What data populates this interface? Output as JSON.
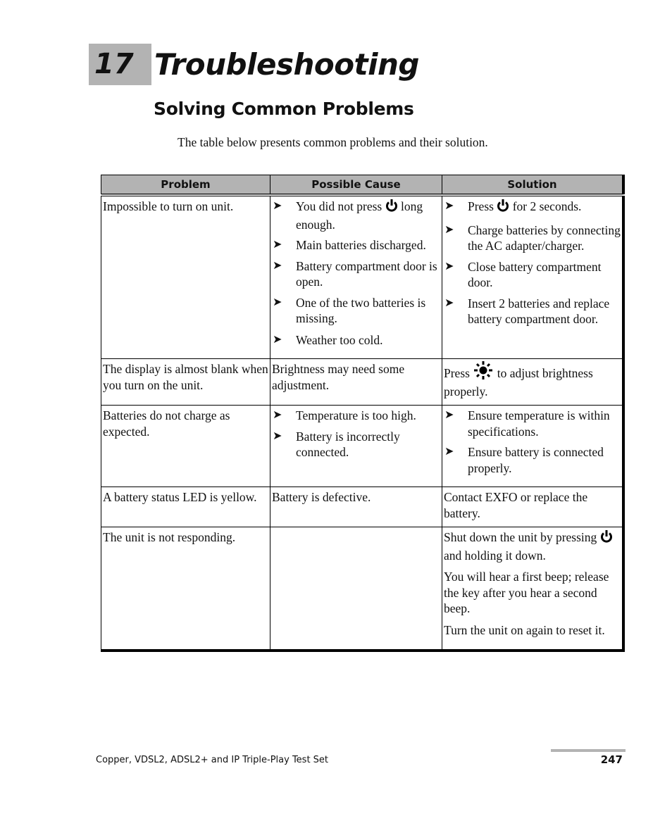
{
  "chapter": {
    "number": "17",
    "title": "Troubleshooting"
  },
  "section": {
    "title": "Solving Common Problems"
  },
  "intro": "The table below presents common problems and their solution.",
  "table": {
    "headers": [
      "Problem",
      "Possible Cause",
      "Solution"
    ],
    "rows": [
      {
        "problem": "Impossible to turn on unit.",
        "causes": [
          {
            "pre": "You did not press ",
            "icon": "power-icon",
            "post": " long enough."
          },
          {
            "pre": "Main batteries discharged."
          },
          {
            "pre": "Battery compartment door is open."
          },
          {
            "pre": "One of the two batteries is missing."
          },
          {
            "pre": "Weather too cold."
          }
        ],
        "solutions": [
          {
            "pre": "Press ",
            "icon": "power-icon",
            "post": " for 2 seconds."
          },
          {
            "pre": "Charge batteries by connecting the AC adapter/charger."
          },
          {
            "pre": "Close battery compartment door."
          },
          {
            "pre": "Insert 2 batteries and replace battery compartment door."
          }
        ]
      },
      {
        "problem": "The display is almost blank when you turn on the unit.",
        "cause": "Brightness may need some adjustment.",
        "solution": {
          "pre": "Press ",
          "icon": "brightness-icon",
          "post": " to adjust brightness properly."
        }
      },
      {
        "problem": "Batteries do not charge as expected.",
        "causes": [
          {
            "pre": "Temperature is too high."
          },
          {
            "pre": "Battery is incorrectly connected."
          }
        ],
        "solutions": [
          {
            "pre": "Ensure temperature is within specifications."
          },
          {
            "pre": "Ensure battery is connected properly."
          }
        ]
      },
      {
        "problem": "A battery status LED is yellow.",
        "cause": "Battery is defective.",
        "solution": {
          "pre": "Contact EXFO or replace the battery."
        }
      },
      {
        "problem": "The unit is not responding.",
        "cause": "",
        "paragraphs": [
          {
            "pre": "Shut down the unit by pressing ",
            "icon": "power-icon",
            "post": " and holding it down."
          },
          {
            "pre": "You will hear a first beep; release the key after you hear a second beep."
          },
          {
            "pre": "Turn the unit on again to reset it."
          }
        ]
      }
    ]
  },
  "footer": {
    "title": "Copper, VDSL2, ADSL2+ and IP Triple-Play Test Set",
    "page": "247"
  },
  "bullet_glyph": "➤"
}
